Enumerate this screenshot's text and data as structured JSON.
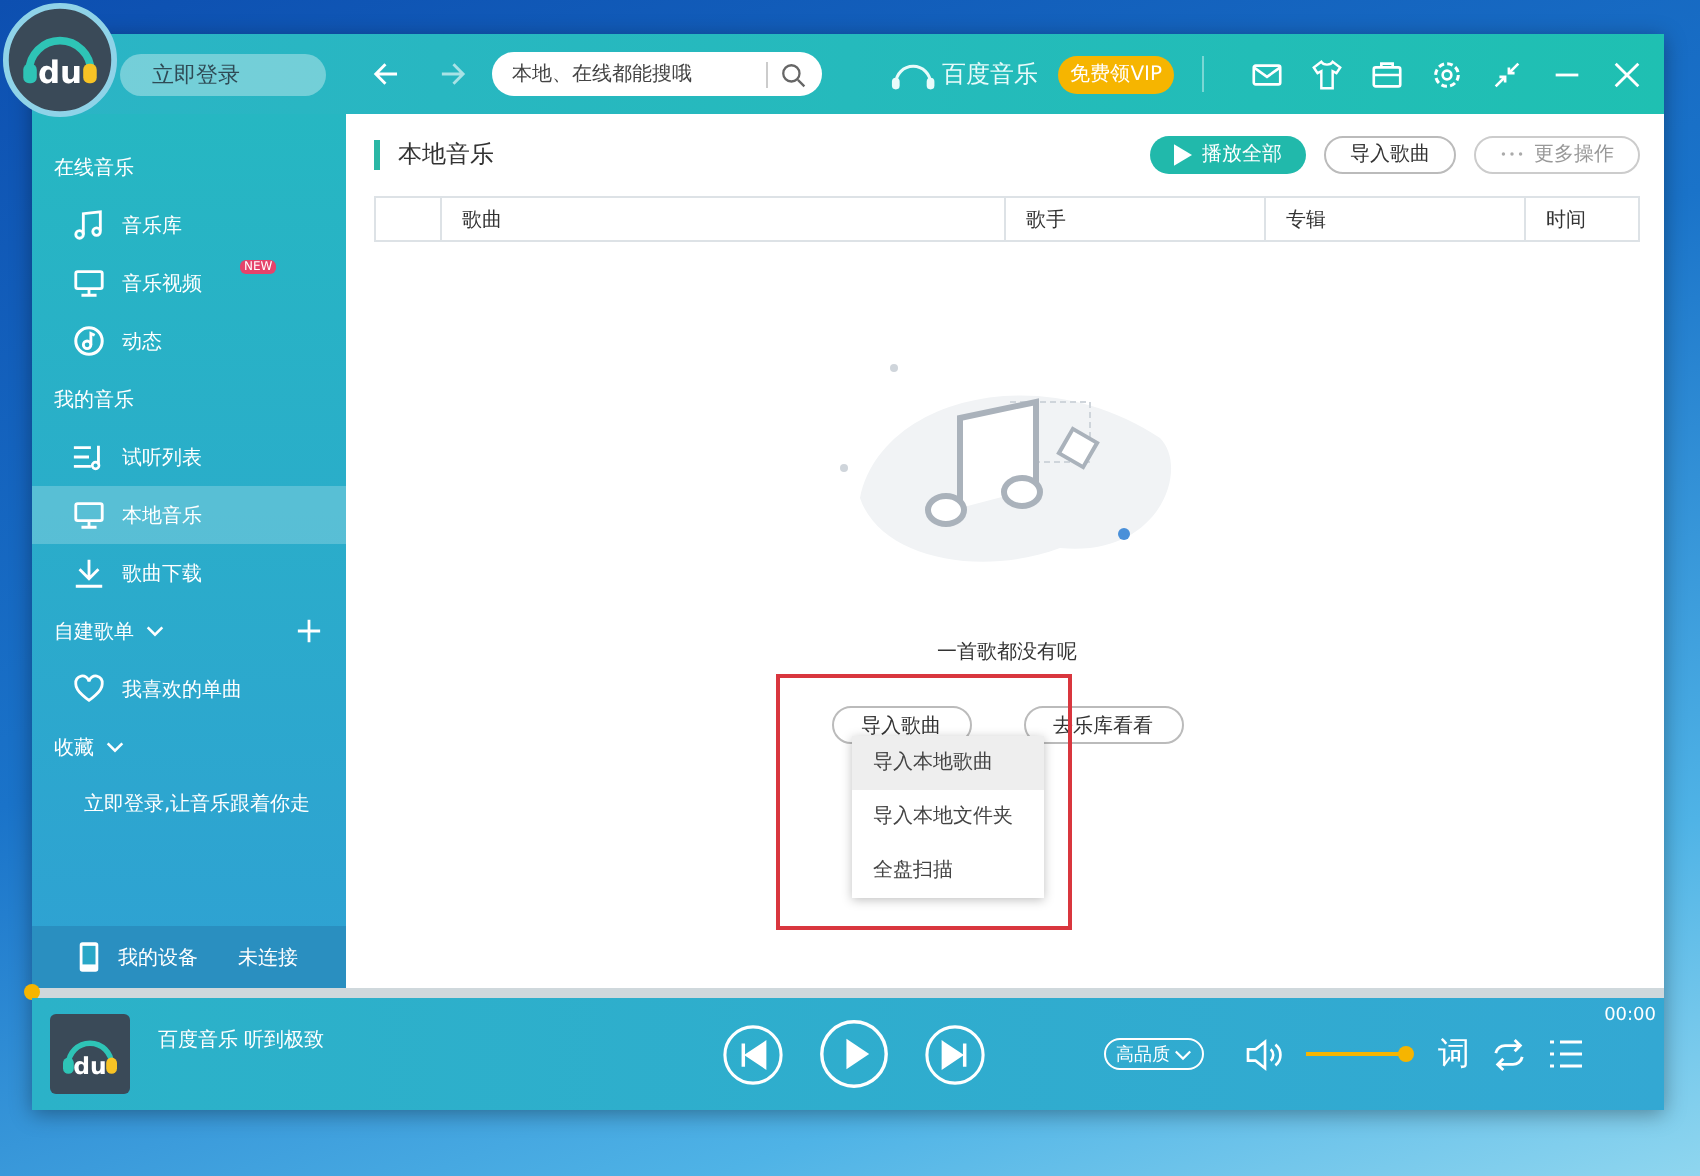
{
  "header": {
    "logo_text": "du",
    "login_label": "立即登录",
    "search": {
      "placeholder": "本地、在线都能搜哦"
    },
    "brand": "百度音乐",
    "vip_badge": "免费领VIP"
  },
  "sidebar": {
    "sections": [
      {
        "title": "在线音乐",
        "can_add": false,
        "items": [
          {
            "kind": "library",
            "label": "音乐库",
            "selected": false
          },
          {
            "kind": "video",
            "label": "音乐视频",
            "badge": "NEW",
            "selected": false
          },
          {
            "kind": "activity",
            "label": "动态",
            "selected": false
          }
        ]
      },
      {
        "title": "我的音乐",
        "can_add": false,
        "items": [
          {
            "kind": "queue",
            "label": "试听列表",
            "selected": false
          },
          {
            "kind": "local",
            "label": "本地音乐",
            "selected": true
          },
          {
            "kind": "downloads",
            "label": "歌曲下载",
            "selected": false
          }
        ]
      },
      {
        "title": "自建歌单",
        "expanded": true,
        "can_add": true,
        "items": [
          {
            "kind": "liked",
            "label": "我喜欢的单曲",
            "selected": false
          }
        ]
      },
      {
        "title": "收藏",
        "expanded": true,
        "can_add": false,
        "items": [
          {
            "kind": "hint",
            "label": "立即登录,让音乐跟着你走"
          }
        ]
      }
    ],
    "device": {
      "label": "我的设备",
      "status": "未连接"
    }
  },
  "content": {
    "title": "本地音乐",
    "actions": [
      {
        "kind": "play",
        "label": "播放全部"
      },
      {
        "kind": "outline",
        "label": "导入歌曲"
      },
      {
        "kind": "more",
        "label": "更多操作"
      }
    ],
    "table": {
      "columns": [
        "歌曲",
        "歌手",
        "专辑",
        "时间"
      ]
    },
    "empty": {
      "message": "一首歌都没有呢",
      "buttons": [
        "导入歌曲",
        "去乐库看看"
      ],
      "menu": [
        {
          "label": "导入本地歌曲",
          "selected": true
        },
        {
          "label": "导入本地文件夹",
          "selected": false
        },
        {
          "label": "全盘扫描",
          "selected": false
        }
      ]
    }
  },
  "player": {
    "progress": {
      "level": 0
    },
    "cover_text": "du",
    "track": "百度音乐 听到极致",
    "time": "00:00",
    "quality": "高品质",
    "volume": {
      "level": 1
    },
    "lyrics": "词"
  }
}
